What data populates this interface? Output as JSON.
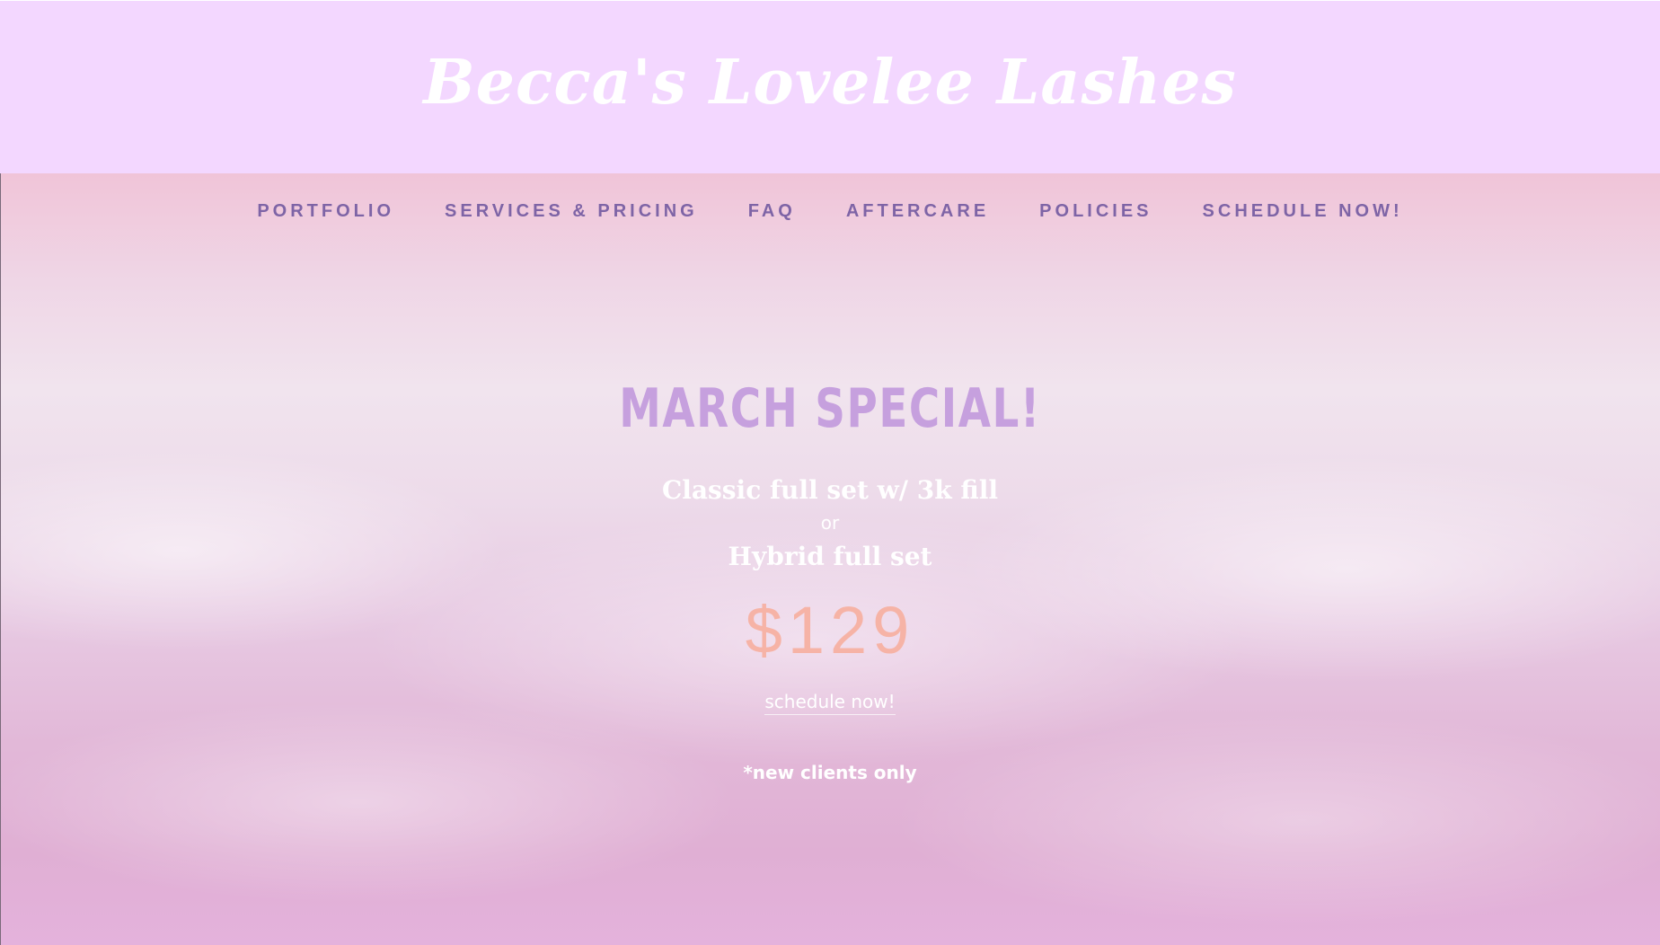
{
  "header": {
    "site_title": "Becca's Lovelee Lashes"
  },
  "nav": {
    "items": [
      {
        "label": "PORTFOLIO"
      },
      {
        "label": "SERVICES & PRICING"
      },
      {
        "label": "FAQ"
      },
      {
        "label": "AFTERCARE"
      },
      {
        "label": "POLICIES"
      },
      {
        "label": "SCHEDULE NOW!"
      }
    ]
  },
  "promo": {
    "heading": "MARCH SPECIAL!",
    "line1": "Classic full set w/ 3k fill",
    "separator": "or",
    "line2": "Hybrid full set",
    "price": "$129",
    "link_label": "schedule now!",
    "note": "*new clients only"
  },
  "colors": {
    "header_bg": "#f3d7ff",
    "nav_text": "#7e64a6",
    "heading": "#c6a0de",
    "price": "#f6b3a6",
    "white_text": "#ffffff"
  }
}
